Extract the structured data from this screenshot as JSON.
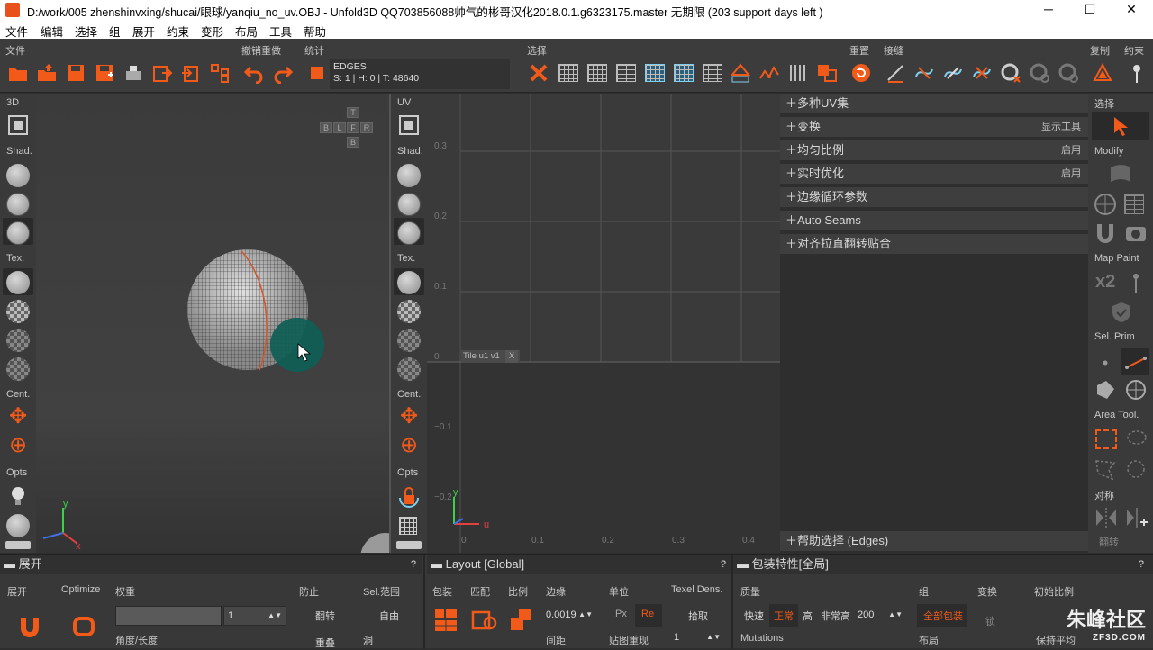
{
  "window": {
    "title": "D:/work/005 zhenshinvxing/shucai/眼球/yanqiu_no_uv.OBJ - Unfold3D QQ703856088帅气的彬哥汉化2018.0.1.g6323175.master 无期限 (203 support days left )",
    "minimize": "─",
    "maximize": "☐",
    "close": "✕"
  },
  "menu": [
    "文件",
    "编辑",
    "选择",
    "组",
    "展开",
    "约束",
    "变形",
    "布局",
    "工具",
    "帮助"
  ],
  "toolbar": {
    "sections": {
      "file": "文件",
      "undo": "撤销重做",
      "stats": "统计",
      "select": "选择",
      "reset": "重置",
      "stitch": "接缝",
      "copy": "复制",
      "constrain": "约束"
    },
    "edges_title": "EDGES",
    "edges_stats": "S: 1 | H: 0 | T: 48640"
  },
  "left_sidebar": {
    "label_3d": "3D",
    "shad": "Shad.",
    "tex": "Tex.",
    "cent": "Cent.",
    "opts": "Opts"
  },
  "uv_sidebar": {
    "label_uv": "UV",
    "shad": "Shad.",
    "tex": "Tex.",
    "cent": "Cent.",
    "opts": "Opts"
  },
  "view_cube": {
    "t": "T",
    "b": "B",
    "l": "L",
    "f": "F",
    "r": "R",
    "bottom": "B"
  },
  "uv_view": {
    "tile_label": "Tile u1  v1",
    "tile_close": "X",
    "y_ticks": [
      "0.3",
      "0.2",
      "0.1",
      "0",
      "−0.1",
      "−0.2"
    ],
    "x_ticks": [
      "0",
      "0.1",
      "0.2",
      "0.3",
      "0.4"
    ],
    "axis_u": "u",
    "axis_v": "y"
  },
  "axis_3d": {
    "y": "y",
    "x": "x"
  },
  "right_panel": {
    "rows": [
      {
        "label": "多种UV集",
        "value": ""
      },
      {
        "label": "变换",
        "value": "显示工具"
      },
      {
        "label": "均匀比例",
        "value": "启用"
      },
      {
        "label": "实时优化",
        "value": "启用"
      },
      {
        "label": "边缘循环参数",
        "value": ""
      },
      {
        "label": "Auto Seams",
        "value": ""
      },
      {
        "label": "对齐拉直翻转贴合",
        "value": ""
      }
    ],
    "help_select": "帮助选择 (Edges)"
  },
  "right_tools": {
    "select": "选择",
    "modify": "Modify",
    "map_paint": "Map Paint",
    "x2": "x2",
    "sel_prim": "Sel. Prim",
    "area_tool": "Area Tool.",
    "symmetry": "对称",
    "bottom": "翻转"
  },
  "bottom": {
    "unfold": {
      "title": "展开",
      "unfold": "展开",
      "optimize": "Optimize",
      "weight": "权重",
      "weight_value": "1",
      "prevent": "防止",
      "flip": "翻转",
      "overlap": "重叠",
      "sel_range": "Sel.范围",
      "free": "自由",
      "hole": "洞",
      "angle_length": "角度/长度"
    },
    "layout": {
      "title": "Layout [Global]",
      "pack": "包装",
      "match": "匹配",
      "ratio": "比例",
      "border": "边缘",
      "border_value": "0.0019",
      "spacing": "间距",
      "unit": "单位",
      "px": "Px",
      "re": "Re",
      "texel": "Texel Dens.",
      "pick": "拾取",
      "map_res": "贴图重现",
      "map_res_value": "1"
    },
    "pack_props": {
      "title": "包装特性[全局]",
      "quality": "质量",
      "fast": "快速",
      "normal": "正常",
      "high": "高",
      "very_high": "非常高",
      "value": "200",
      "mutations": "Mutations",
      "group": "组",
      "pack_all": "全部包装",
      "layout": "布局",
      "transform": "变换",
      "lock": "锁",
      "init_ratio": "初始比例",
      "keep_avg": "保持平均",
      "help": "?"
    }
  },
  "watermark": "朱峰社区",
  "watermark_url": "ZF3D.COM"
}
